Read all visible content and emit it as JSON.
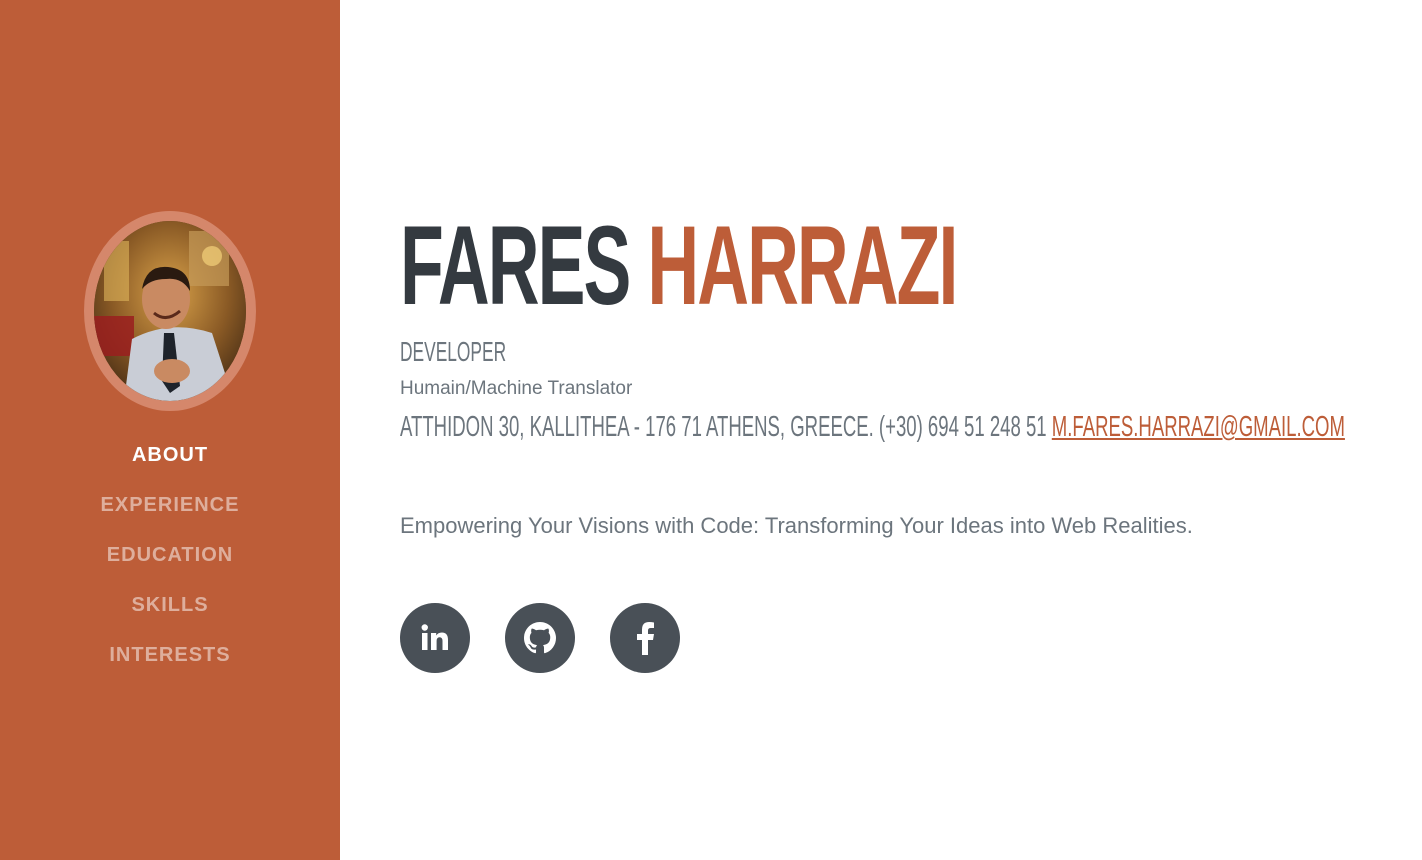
{
  "sidebar": {
    "nav": [
      {
        "label": "ABOUT",
        "active": true
      },
      {
        "label": "EXPERIENCE",
        "active": false
      },
      {
        "label": "EDUCATION",
        "active": false
      },
      {
        "label": "SKILLS",
        "active": false
      },
      {
        "label": "INTERESTS",
        "active": false
      }
    ]
  },
  "profile": {
    "first_name": "FARES",
    "last_name": "HARRAZI",
    "title": "DEVELOPER",
    "subtitle": "Humain/Machine Translator",
    "address": "ATTHIDON 30, KALLITHEA - 176 71 ATHENS, GREECE. (+30) 694 51 248 51",
    "email": "M.FARES.HARRAZI@GMAIL.COM",
    "tagline": "Empowering Your Visions with Code: Transforming Your Ideas into Web Realities."
  },
  "socials": [
    {
      "icon": "linkedin-icon"
    },
    {
      "icon": "github-icon"
    },
    {
      "icon": "facebook-icon"
    }
  ],
  "colors": {
    "accent": "#bd5d38",
    "heading": "#343a40",
    "muted": "#6c757d",
    "social_bg": "#495057"
  }
}
